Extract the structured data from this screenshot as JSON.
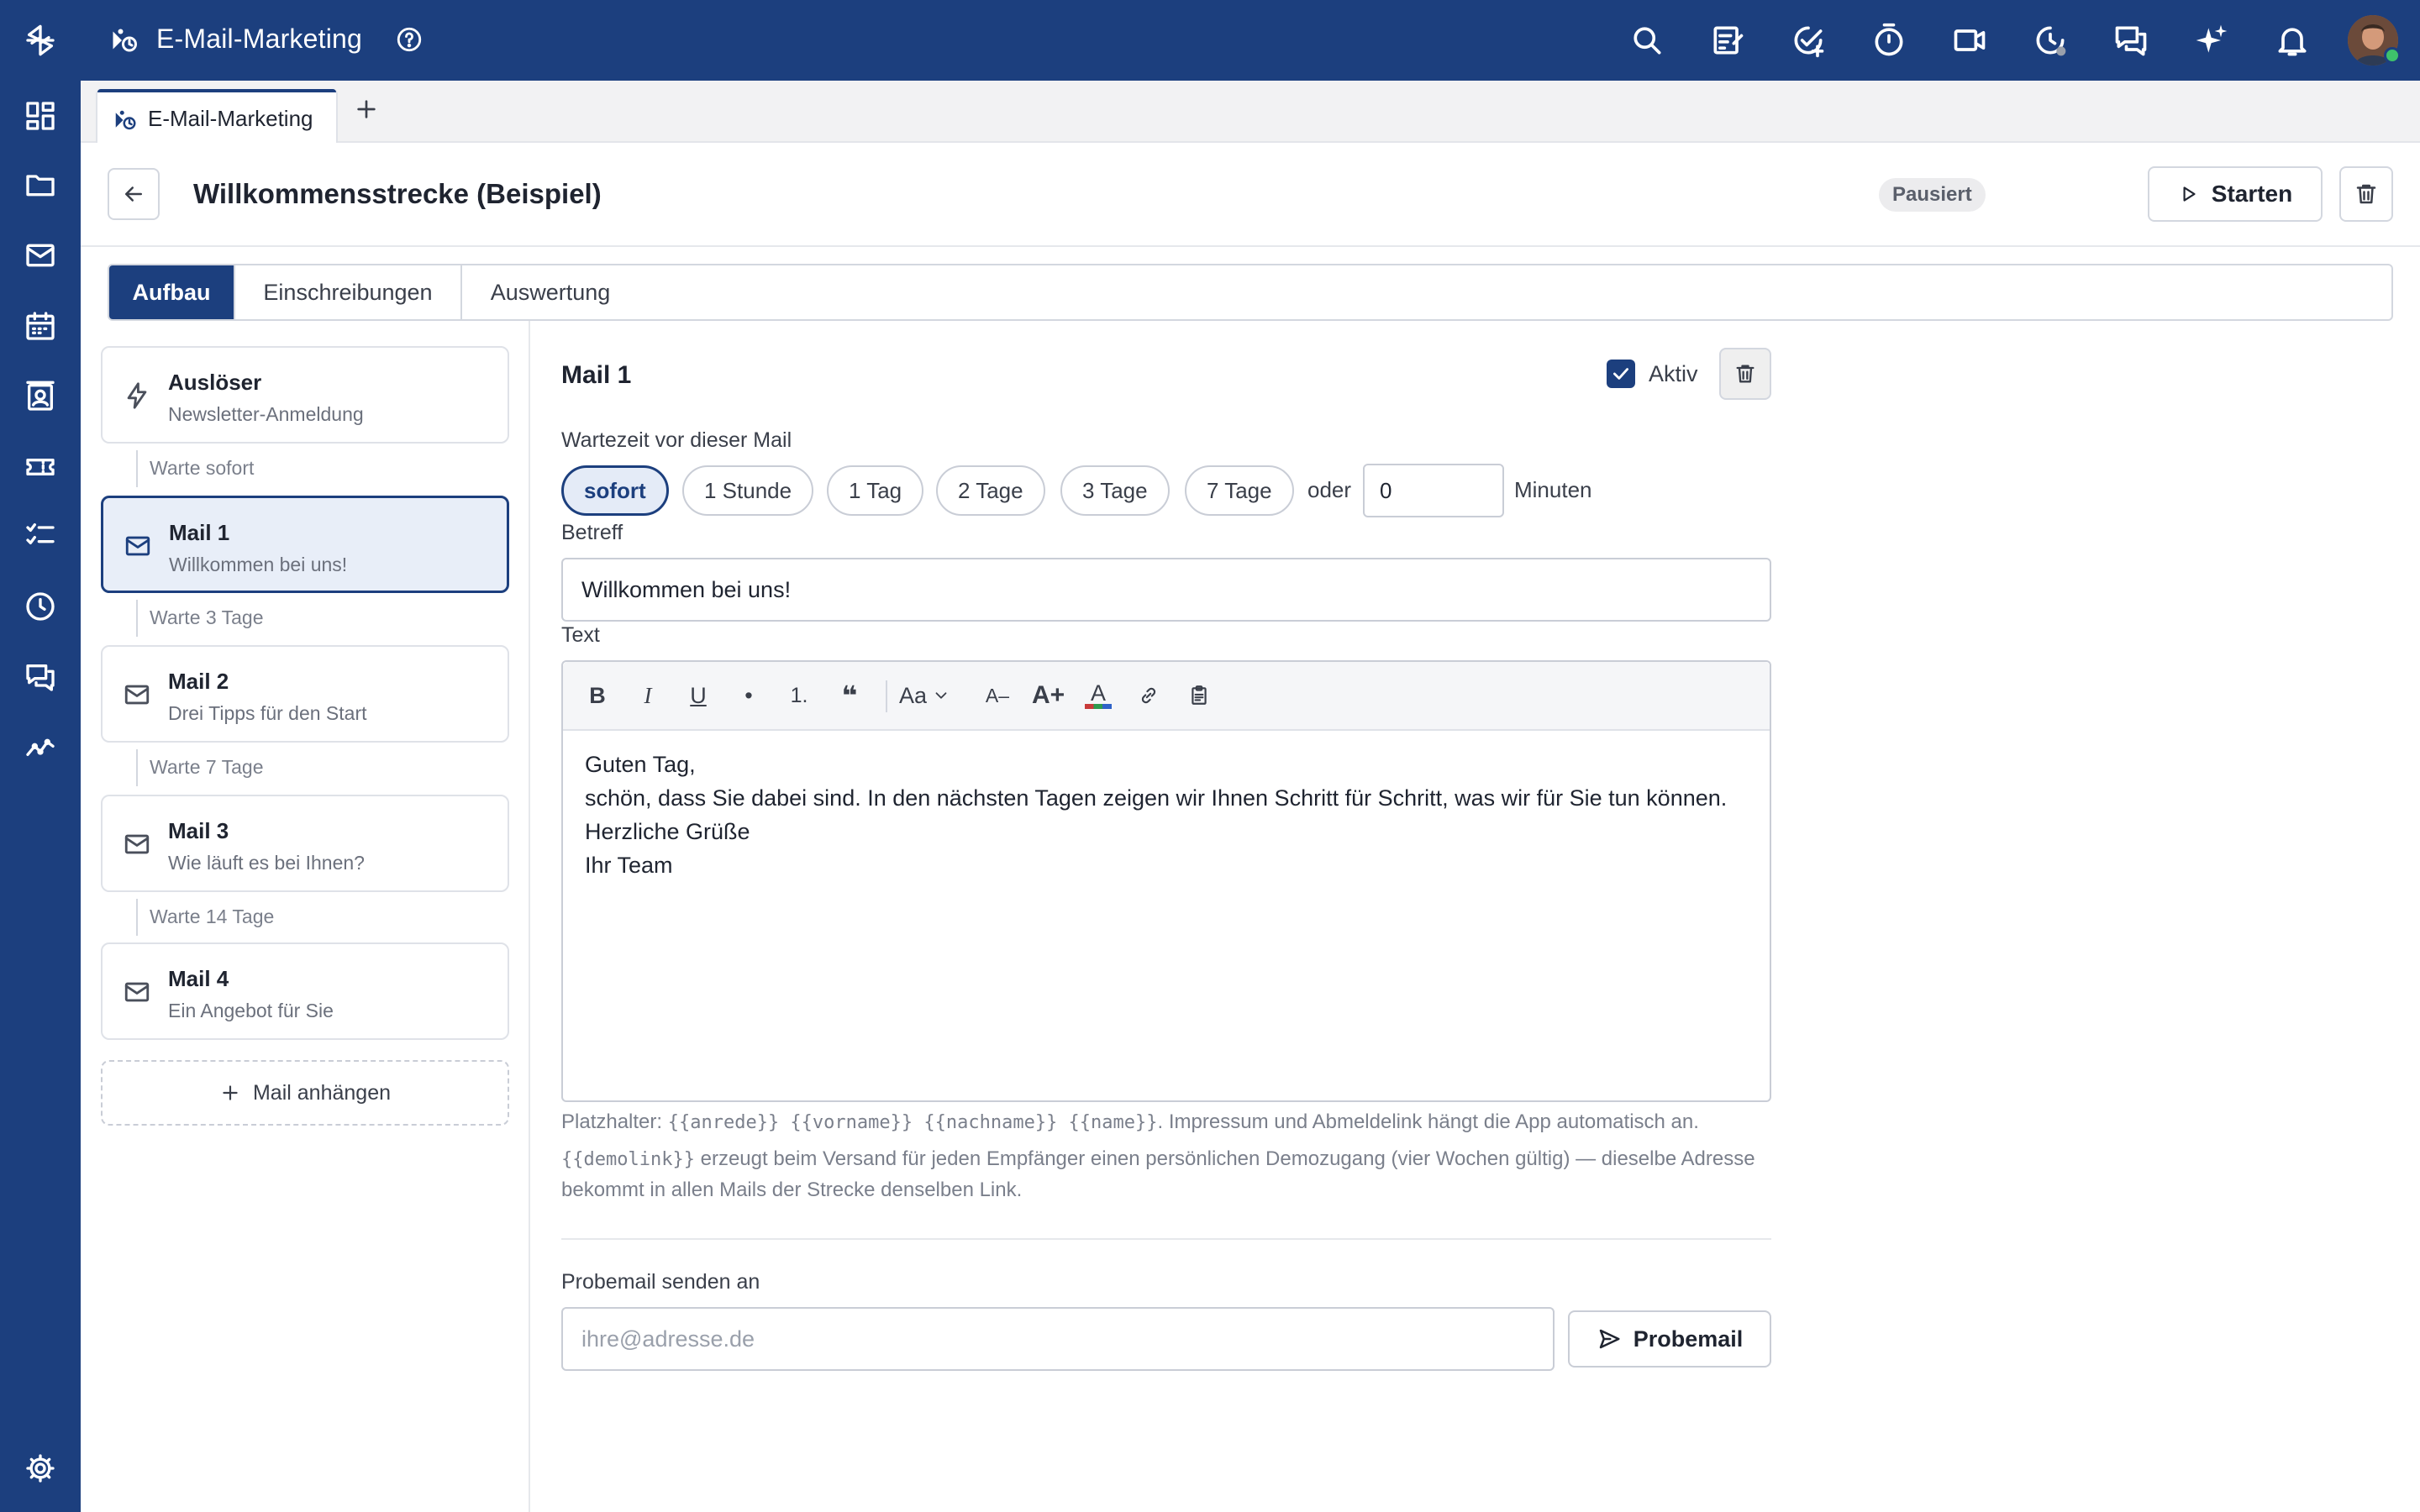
{
  "app": {
    "title": "E-Mail-Marketing"
  },
  "tabs": [
    {
      "label": "E-Mail-Marketing"
    }
  ],
  "header": {
    "title": "Willkommensstrecke (Beispiel)",
    "status": "Pausiert",
    "start_label": "Starten"
  },
  "section_tabs": [
    {
      "label": "Aufbau"
    },
    {
      "label": "Einschreibungen"
    },
    {
      "label": "Auswertung"
    }
  ],
  "steps": [
    {
      "title": "Auslöser",
      "subtitle": "Newsletter-Anmeldung",
      "icon": "bolt-icon"
    },
    {
      "wait": "Warte sofort"
    },
    {
      "title": "Mail 1",
      "subtitle": "Willkommen bei uns!",
      "icon": "mail-icon"
    },
    {
      "wait": "Warte 3 Tage"
    },
    {
      "title": "Mail 2",
      "subtitle": "Drei Tipps für den Start",
      "icon": "mail-icon"
    },
    {
      "wait": "Warte 7 Tage"
    },
    {
      "title": "Mail 3",
      "subtitle": "Wie läuft es bei Ihnen?",
      "icon": "mail-icon"
    },
    {
      "wait": "Warte 14 Tage"
    },
    {
      "title": "Mail 4",
      "subtitle": "Ein Angebot für Sie",
      "icon": "mail-icon"
    }
  ],
  "add_mail_label": "Mail anhängen",
  "editor": {
    "mail_title": "Mail 1",
    "active_label": "Aktiv",
    "active_checked": true,
    "wait_label": "Wartezeit vor dieser Mail",
    "wait_options": [
      "sofort",
      "1 Stunde",
      "1 Tag",
      "2 Tage",
      "3 Tage",
      "7 Tage"
    ],
    "wait_selected": "sofort",
    "oder": "oder",
    "minutes_value": "0",
    "minutes_label": "Minuten",
    "subject_label": "Betreff",
    "subject_value": "Willkommen bei uns!",
    "text_label": "Text",
    "toolbar": {
      "bold": "B",
      "italic": "I",
      "underline": "U",
      "bullet": "•",
      "numbered": "1.",
      "quote": "❝",
      "font_size": "Aa",
      "smaller": "A–",
      "larger": "A+",
      "color": "A"
    },
    "body_lines": [
      "Guten Tag,",
      "schön, dass Sie dabei sind. In den nächsten Tagen zeigen wir Ihnen Schritt für Schritt, was wir für Sie tun können.",
      "Herzliche Grüße",
      "Ihr Team"
    ],
    "hint1_prefix": "Platzhalter:",
    "hint1_placeholders": "{{anrede}} {{vorname}} {{nachname}} {{name}}",
    "hint1_suffix": ". Impressum und Abmeldelink hängt die App automatisch an.",
    "hint2_code": "{{demolink}}",
    "hint2_text": " erzeugt beim Versand für jeden Empfänger einen persönlichen Demozugang (vier Wochen gültig) — dieselbe Adresse bekommt in allen Mails der Strecke denselben Link.",
    "test_label": "Probemail senden an",
    "test_placeholder": "ihre@adresse.de",
    "test_button": "Probemail"
  },
  "colors": {
    "brand": "#1c3f7e",
    "selected_bg": "#e8eef8",
    "online": "#3ec26b"
  }
}
